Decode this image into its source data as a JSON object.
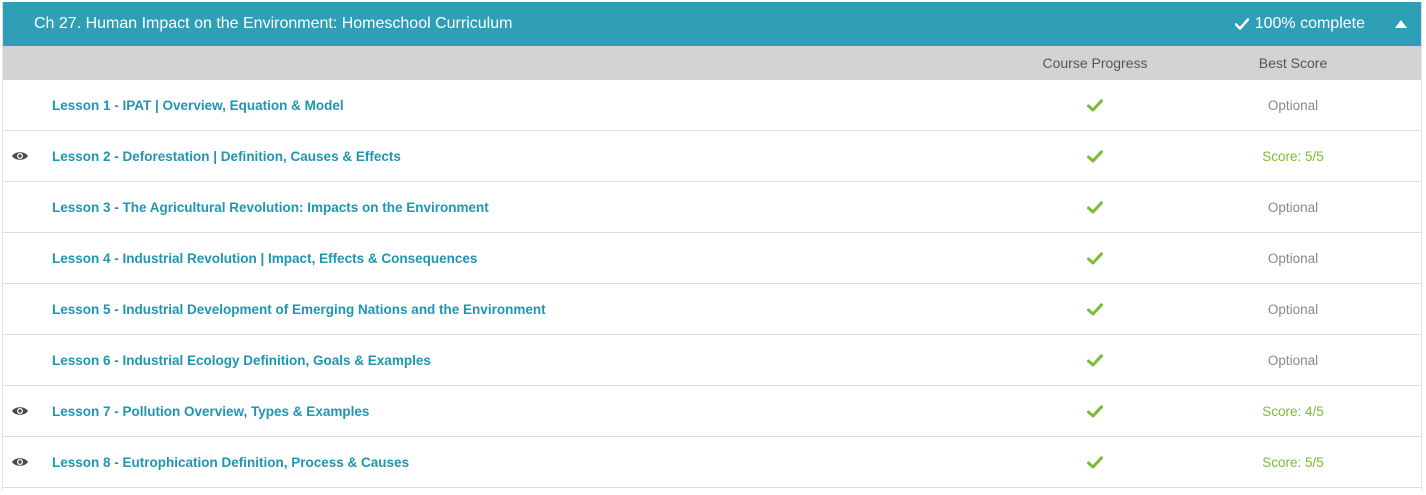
{
  "chapter": {
    "title": "Ch 27. Human Impact on the Environment: Homeschool Curriculum",
    "complete_label": "100% complete"
  },
  "columns": {
    "progress": "Course Progress",
    "score": "Best Score"
  },
  "colors": {
    "header_bg": "#2e9fb7",
    "link": "#1f96b1",
    "check": "#7cbc36",
    "score": "#7cbc36",
    "optional": "#8a8a8a"
  },
  "lessons": [
    {
      "title": "Lesson 1 - IPAT | Overview, Equation & Model",
      "viewed": false,
      "completed": true,
      "score": "Optional"
    },
    {
      "title": "Lesson 2 - Deforestation | Definition, Causes & Effects",
      "viewed": true,
      "completed": true,
      "score": "Score: 5/5"
    },
    {
      "title": "Lesson 3 - The Agricultural Revolution: Impacts on the Environment",
      "viewed": false,
      "completed": true,
      "score": "Optional"
    },
    {
      "title": "Lesson 4 - Industrial Revolution | Impact, Effects & Consequences",
      "viewed": false,
      "completed": true,
      "score": "Optional"
    },
    {
      "title": "Lesson 5 - Industrial Development of Emerging Nations and the Environment",
      "viewed": false,
      "completed": true,
      "score": "Optional"
    },
    {
      "title": "Lesson 6 - Industrial Ecology Definition, Goals & Examples",
      "viewed": false,
      "completed": true,
      "score": "Optional"
    },
    {
      "title": "Lesson 7 - Pollution Overview, Types & Examples",
      "viewed": true,
      "completed": true,
      "score": "Score: 4/5"
    },
    {
      "title": "Lesson 8 - Eutrophication Definition, Process & Causes",
      "viewed": true,
      "completed": true,
      "score": "Score: 5/5"
    }
  ]
}
